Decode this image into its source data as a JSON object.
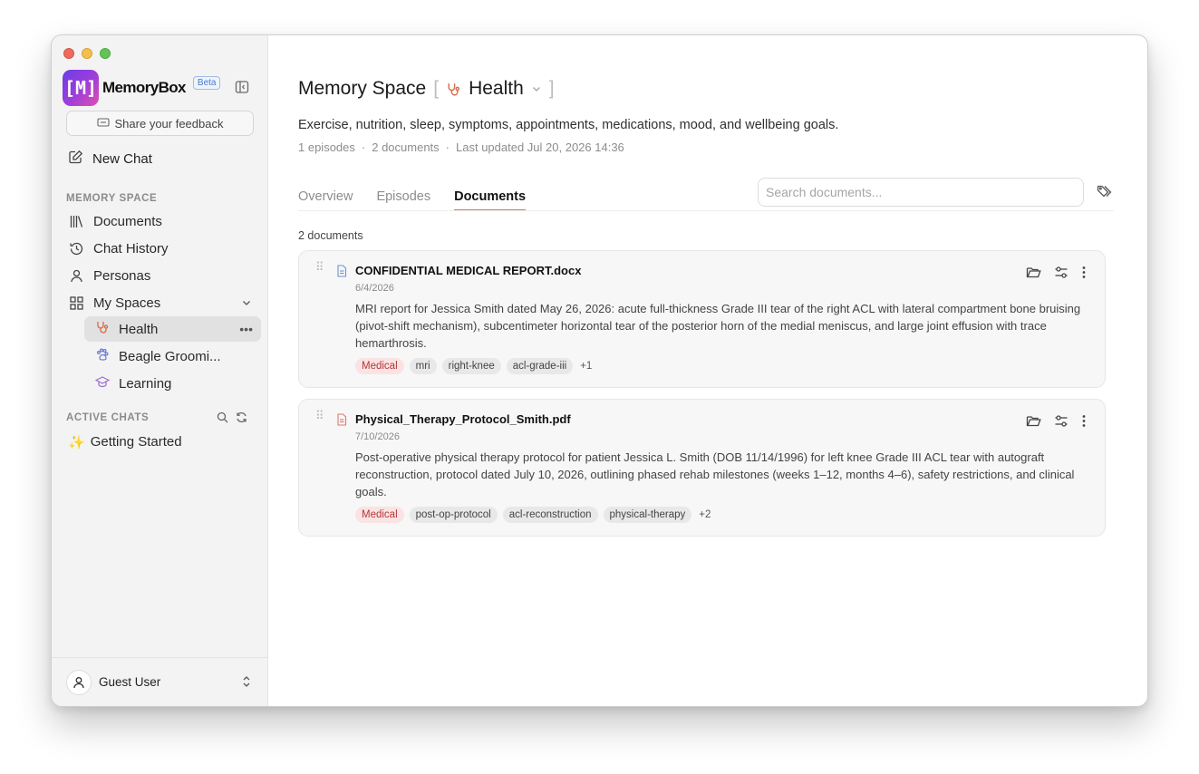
{
  "sidebar": {
    "brand": {
      "logo_text": "[M]",
      "name": "MemoryBox",
      "badge": "Beta"
    },
    "feedback_label": "Share your feedback",
    "new_chat_label": "New Chat",
    "memory_space_heading": "MEMORY SPACE",
    "items": [
      {
        "label": "Documents",
        "icon": "documents-icon"
      },
      {
        "label": "Chat History",
        "icon": "history-icon"
      },
      {
        "label": "Personas",
        "icon": "person-icon"
      },
      {
        "label": "My Spaces",
        "icon": "grid-icon"
      }
    ],
    "spaces": [
      {
        "label": "Health",
        "icon": "stethoscope-icon",
        "active": true
      },
      {
        "label": "Beagle Groomi...",
        "icon": "paw-icon",
        "active": false
      },
      {
        "label": "Learning",
        "icon": "graduation-cap-icon",
        "active": false
      }
    ],
    "active_chats_heading": "ACTIVE CHATS",
    "chats": [
      {
        "emoji": "✨",
        "label": "Getting Started"
      }
    ],
    "user": {
      "name": "Guest User"
    }
  },
  "main": {
    "title": "Memory Space",
    "space_name": "Health",
    "description": "Exercise, nutrition, sleep, symptoms, appointments, medications, mood, and wellbeing goals.",
    "meta": {
      "episodes": "1 episodes",
      "documents": "2 documents",
      "updated": "Last updated Jul 20, 2026 14:36",
      "separator": "·"
    },
    "tabs": [
      {
        "label": "Overview",
        "active": false
      },
      {
        "label": "Episodes",
        "active": false
      },
      {
        "label": "Documents",
        "active": true
      }
    ],
    "search": {
      "placeholder": "Search documents..."
    },
    "doc_count": "2 documents",
    "documents": [
      {
        "name": "CONFIDENTIAL MEDICAL REPORT.docx",
        "date": "6/4/2026",
        "type": "docx",
        "summary": "MRI report for Jessica Smith dated May 26, 2026: acute full-thickness Grade III tear of the right ACL with lateral compartment bone bruising (pivot-shift mechanism), subcentimeter horizontal tear of the posterior horn of the medial meniscus, and large joint effusion with trace hemarthrosis.",
        "tags": [
          "Medical",
          "mri",
          "right-knee",
          "acl-grade-iii"
        ],
        "more": "+1"
      },
      {
        "name": "Physical_Therapy_Protocol_Smith.pdf",
        "date": "7/10/2026",
        "type": "pdf",
        "summary": "Post-operative physical therapy protocol for patient Jessica L. Smith (DOB 11/14/1996) for left knee Grade III ACL tear with autograft reconstruction, protocol dated July 10, 2026, outlining phased rehab milestones (weeks 1–12, months 4–6), safety restrictions, and clinical goals.",
        "tags": [
          "Medical",
          "post-op-protocol",
          "acl-reconstruction",
          "physical-therapy"
        ],
        "more": "+2"
      }
    ]
  },
  "colors": {
    "accent": "#d47a5d",
    "medical_tag_bg": "#fbe3e3",
    "medical_tag_text": "#b43636",
    "sidebar_bg": "#f3f3f3"
  }
}
